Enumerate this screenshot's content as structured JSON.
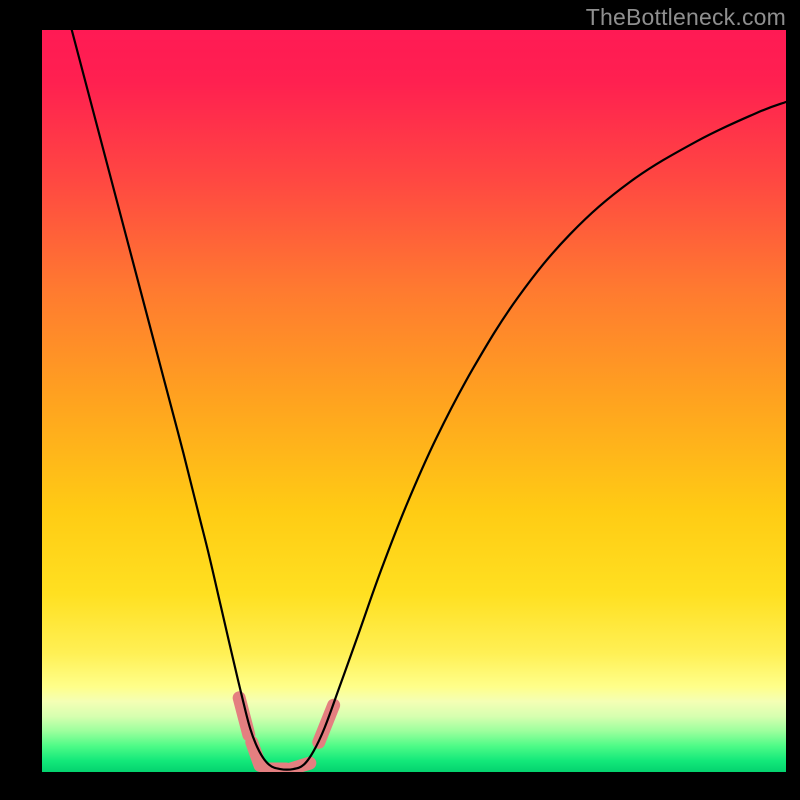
{
  "watermark": "TheBottleneck.com",
  "chart_data": {
    "type": "line",
    "title": "",
    "xlabel": "",
    "ylabel": "",
    "xlim": [
      0,
      1
    ],
    "ylim": [
      0,
      1
    ],
    "background_gradient_stops": [
      {
        "offset": 0.0,
        "color": "#ff1a54"
      },
      {
        "offset": 0.07,
        "color": "#ff2050"
      },
      {
        "offset": 0.2,
        "color": "#ff4742"
      },
      {
        "offset": 0.35,
        "color": "#ff7a30"
      },
      {
        "offset": 0.5,
        "color": "#ffa31f"
      },
      {
        "offset": 0.65,
        "color": "#ffcc14"
      },
      {
        "offset": 0.76,
        "color": "#ffe021"
      },
      {
        "offset": 0.84,
        "color": "#fff055"
      },
      {
        "offset": 0.885,
        "color": "#ffff8a"
      },
      {
        "offset": 0.905,
        "color": "#f4ffb5"
      },
      {
        "offset": 0.925,
        "color": "#d6ffb0"
      },
      {
        "offset": 0.945,
        "color": "#9cff9d"
      },
      {
        "offset": 0.965,
        "color": "#4efb87"
      },
      {
        "offset": 0.985,
        "color": "#13e87a"
      },
      {
        "offset": 1.0,
        "color": "#04d26f"
      }
    ],
    "series": [
      {
        "name": "bottleneck-curve",
        "stroke": "#000000",
        "stroke_width": 2.2,
        "points": [
          [
            0.04,
            1.0
          ],
          [
            0.065,
            0.905
          ],
          [
            0.09,
            0.81
          ],
          [
            0.115,
            0.715
          ],
          [
            0.14,
            0.62
          ],
          [
            0.165,
            0.525
          ],
          [
            0.19,
            0.43
          ],
          [
            0.21,
            0.35
          ],
          [
            0.225,
            0.29
          ],
          [
            0.24,
            0.225
          ],
          [
            0.255,
            0.16
          ],
          [
            0.268,
            0.105
          ],
          [
            0.28,
            0.058
          ],
          [
            0.292,
            0.028
          ],
          [
            0.305,
            0.01
          ],
          [
            0.32,
            0.004
          ],
          [
            0.338,
            0.004
          ],
          [
            0.352,
            0.01
          ],
          [
            0.365,
            0.028
          ],
          [
            0.38,
            0.06
          ],
          [
            0.4,
            0.115
          ],
          [
            0.425,
            0.185
          ],
          [
            0.455,
            0.27
          ],
          [
            0.49,
            0.36
          ],
          [
            0.53,
            0.45
          ],
          [
            0.58,
            0.545
          ],
          [
            0.64,
            0.64
          ],
          [
            0.71,
            0.725
          ],
          [
            0.79,
            0.795
          ],
          [
            0.88,
            0.85
          ],
          [
            0.96,
            0.888
          ],
          [
            1.0,
            0.903
          ]
        ]
      },
      {
        "name": "marker-left-upper",
        "type": "marker-pill",
        "fill": "#e47f80",
        "points": [
          [
            0.265,
            0.1
          ],
          [
            0.278,
            0.05
          ]
        ]
      },
      {
        "name": "marker-left-lower",
        "type": "marker-pill",
        "fill": "#e47f80",
        "points": [
          [
            0.282,
            0.04
          ],
          [
            0.293,
            0.009
          ]
        ]
      },
      {
        "name": "marker-bottom-left",
        "type": "marker-pill",
        "fill": "#e47f80",
        "points": [
          [
            0.3,
            0.004
          ],
          [
            0.328,
            0.004
          ]
        ]
      },
      {
        "name": "marker-bottom-right",
        "type": "marker-pill",
        "fill": "#e47f80",
        "points": [
          [
            0.334,
            0.004
          ],
          [
            0.36,
            0.012
          ]
        ]
      },
      {
        "name": "marker-right-upper",
        "type": "marker-pill",
        "fill": "#e47f80",
        "points": [
          [
            0.372,
            0.04
          ],
          [
            0.392,
            0.09
          ]
        ]
      }
    ]
  }
}
